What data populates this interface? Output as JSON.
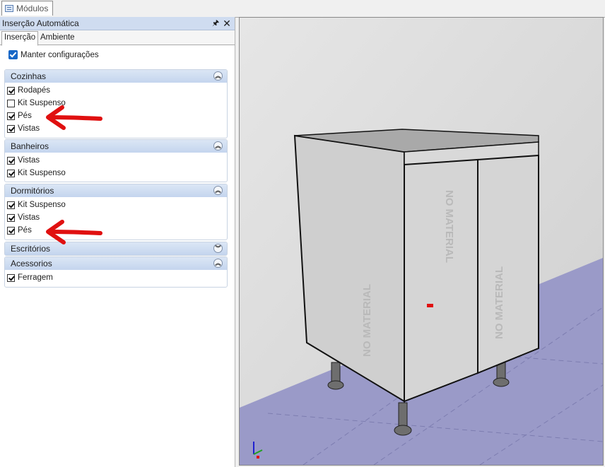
{
  "window_tab": {
    "label": "Módulos"
  },
  "panel": {
    "title": "Inserção Automática",
    "tabs": [
      "Inserção",
      "Ambiente"
    ],
    "keep_settings": {
      "label": "Manter configurações",
      "checked": true
    }
  },
  "groups": [
    {
      "title": "Cozinhas",
      "expanded": true,
      "items": [
        {
          "label": "Rodapés",
          "checked": true
        },
        {
          "label": "Kit Suspenso",
          "checked": false
        },
        {
          "label": "Pés",
          "checked": true
        },
        {
          "label": "Vistas",
          "checked": true
        }
      ]
    },
    {
      "title": "Banheiros",
      "expanded": true,
      "items": [
        {
          "label": "Vistas",
          "checked": true
        },
        {
          "label": "Kit Suspenso",
          "checked": true
        }
      ]
    },
    {
      "title": "Dormitórios",
      "expanded": true,
      "items": [
        {
          "label": "Kit Suspenso",
          "checked": true
        },
        {
          "label": "Vistas",
          "checked": true
        },
        {
          "label": "Pés",
          "checked": true
        }
      ]
    },
    {
      "title": "Escritórios",
      "expanded": false,
      "items": []
    },
    {
      "title": "Acessorios",
      "expanded": true,
      "items": [
        {
          "label": "Ferragem",
          "checked": true
        }
      ]
    }
  ],
  "viewport": {
    "door_text": "NO MATERIAL",
    "colors": {
      "floor": "#9a9ac8",
      "wall": "#d8d8d8",
      "cabinet": "#d2d2d2",
      "annotation_arrow": "#e01010"
    }
  }
}
